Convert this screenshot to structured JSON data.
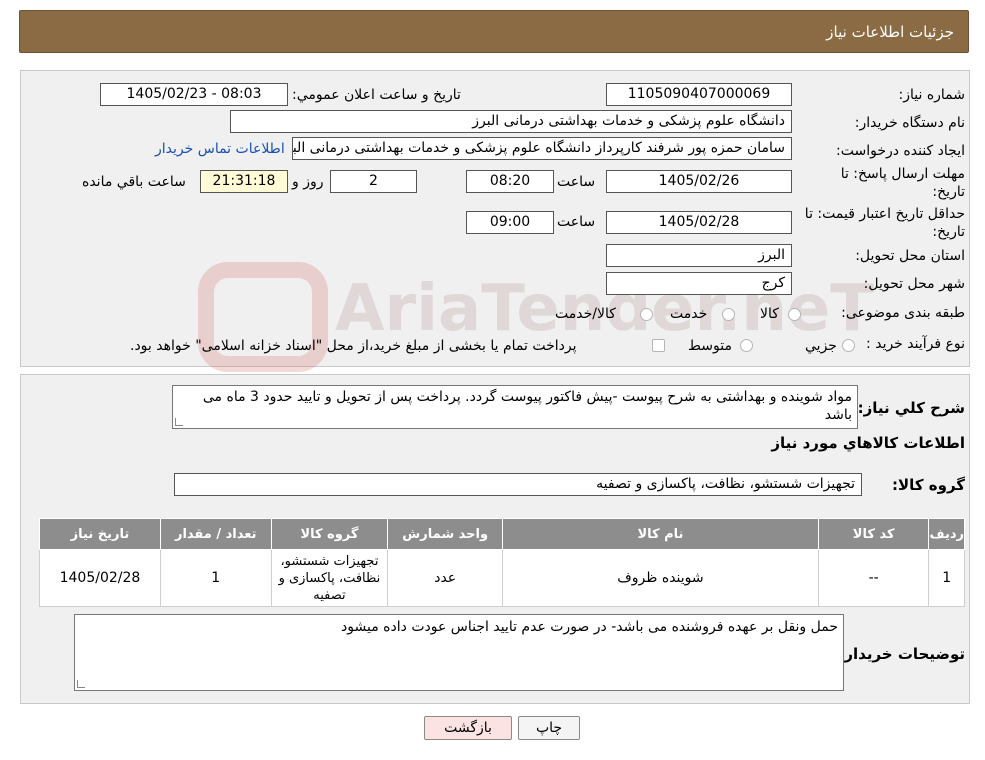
{
  "header": {
    "title": "جزئیات اطلاعات نیاز"
  },
  "details": {
    "need_number_label": "شماره نیاز:",
    "need_number": "1105090407000069",
    "announce_label": "تاریخ و ساعت اعلان عمومي:",
    "announce_value": "1405/02/23 - 08:03",
    "buyer_org_label": "نام دستگاه خريدار:",
    "buyer_org": "دانشگاه علوم پزشکی و خدمات بهداشتی  درمانی البرز",
    "creator_label": "ايجاد کننده درخواست:",
    "creator": "سامان حمزه پور شرفند کارپرداز دانشگاه علوم پزشکی و خدمات بهداشتی  درمانی البرز",
    "contact_link": "اطلاعات تماس خريدار",
    "deadline_label_1": "مهلت ارسال پاسخ: تا",
    "deadline_label_2": "تاريخ:",
    "deadline_date": "1405/02/26",
    "time_label": "ساعت",
    "deadline_time": "08:20",
    "days_value": "2",
    "days_label": "روز و",
    "remaining_time": "21:31:18",
    "remaining_label": "ساعت باقي مانده",
    "validity_label_1": "حداقل تاريخ اعتبار قيمت: تا",
    "validity_label_2": "تاريخ:",
    "validity_date": "1405/02/28",
    "validity_time": "09:00",
    "province_label": "استان محل تحويل:",
    "province": "البرز",
    "city_label": "شهر محل تحويل:",
    "city": "کرج",
    "category_label": "طبقه بندی موضوعی:",
    "category_options": [
      "کالا",
      "خدمت",
      "کالا/خدمت"
    ],
    "process_label": "نوع فرآیند خرید :",
    "process_options": [
      "جزيي",
      "متوسط"
    ],
    "process_note": "پرداخت تمام يا بخشی از مبلغ خريد،از محل \"اسناد خزانه اسلامی\" خواهد بود."
  },
  "summary": {
    "description_label": "شرح کلي نياز:",
    "description": "مواد شوینده و بهداشتی به شرح پیوست -پیش فاکتور پیوست گردد. پرداخت پس از تحویل و تایید حدود 3 ماه می باشد",
    "goods_info_title": "اطلاعات کالاهاي مورد نياز",
    "goods_group_label": "گروه کالا:",
    "goods_group": "تجهیزات شستشو، نظافت، پاکسازی و تصفیه",
    "table": {
      "headers": [
        "رديف",
        "کد کالا",
        "نام کالا",
        "واحد شمارش",
        "گروه کالا",
        "تعداد / مقدار",
        "تاريخ نياز"
      ],
      "rows": [
        [
          "1",
          "--",
          "شوینده ظروف",
          "عدد",
          "تجهیزات شستشو، نظافت، پاکسازی و تصفیه",
          "1",
          "1405/02/28"
        ]
      ]
    },
    "buyer_notes_label": "توضيحات خريدار:",
    "buyer_notes": "حمل ونقل بر عهده فروشنده می باشد- در صورت عدم تایید اجناس عودت داده میشود"
  },
  "buttons": {
    "print": "چاپ",
    "back": "بازگشت"
  },
  "watermark": {
    "text": "AriaTender.neT"
  },
  "colors": {
    "header_bg": "#8b6b43",
    "table_header_bg": "#8d8d8d",
    "back_button_bg": "#fbe3e3"
  }
}
